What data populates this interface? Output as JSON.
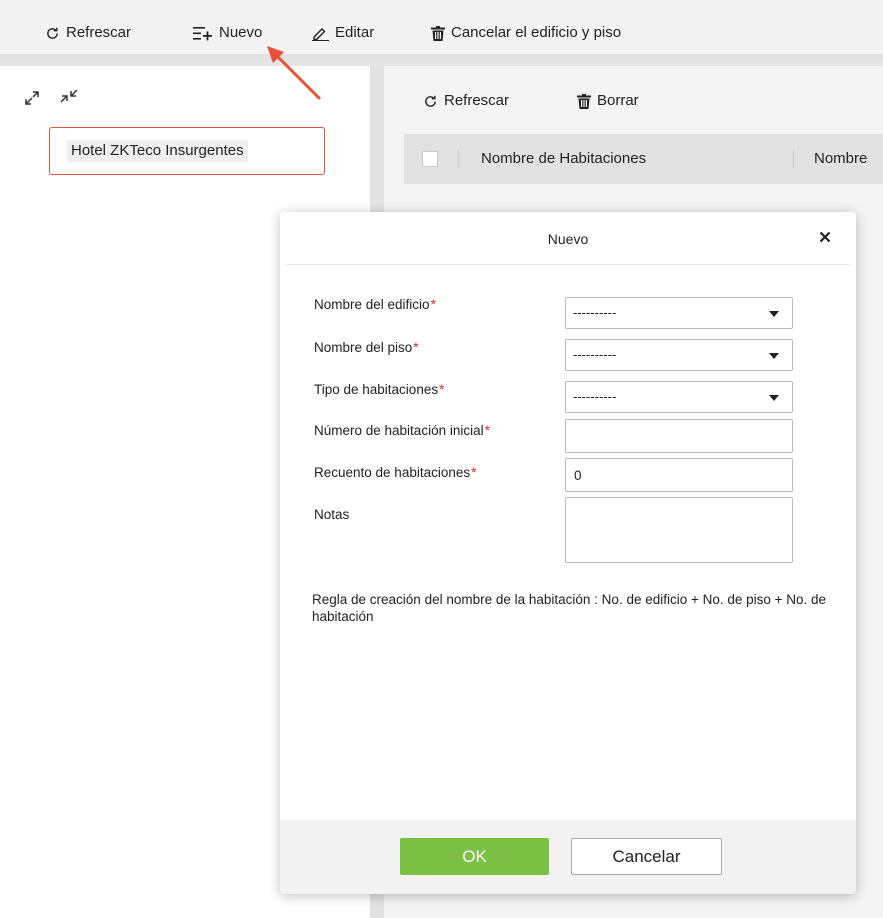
{
  "toolbar": {
    "refresh": "Refrescar",
    "new": "Nuevo",
    "edit": "Editar",
    "cancel_building": "Cancelar el edificio y piso"
  },
  "tree": {
    "node_label": "Hotel ZKTeco Insurgentes"
  },
  "rooms_panel": {
    "refresh": "Refrescar",
    "delete": "Borrar",
    "columns": [
      "Nombre de Habitaciones",
      "Nombre"
    ]
  },
  "modal": {
    "title": "Nuevo",
    "close_icon": "close-icon",
    "fields": {
      "building": {
        "label": "Nombre del edificio",
        "required_mark": "*",
        "value": "----------"
      },
      "floor": {
        "label": "Nombre del piso",
        "required_mark": "*",
        "value": "----------"
      },
      "room_type": {
        "label": "Tipo de habitaciones",
        "required_mark": "*",
        "value": "----------"
      },
      "start_number": {
        "label": "Número de habitación inicial",
        "required_mark": "*",
        "value": ""
      },
      "room_count": {
        "label": "Recuento de habitaciones",
        "required_mark": "*",
        "value": "0"
      },
      "notes": {
        "label": "Notas",
        "value": ""
      }
    },
    "rule_note": "Regla de creación del nombre de la habitación : No. de edificio + No. de piso + No. de habitación",
    "ok": "OK",
    "cancel": "Cancelar"
  },
  "colors": {
    "ok_button": "#7ac143",
    "required_star": "#e5221b",
    "highlight_border": "#e5533f",
    "arrow": "#e8503a"
  }
}
